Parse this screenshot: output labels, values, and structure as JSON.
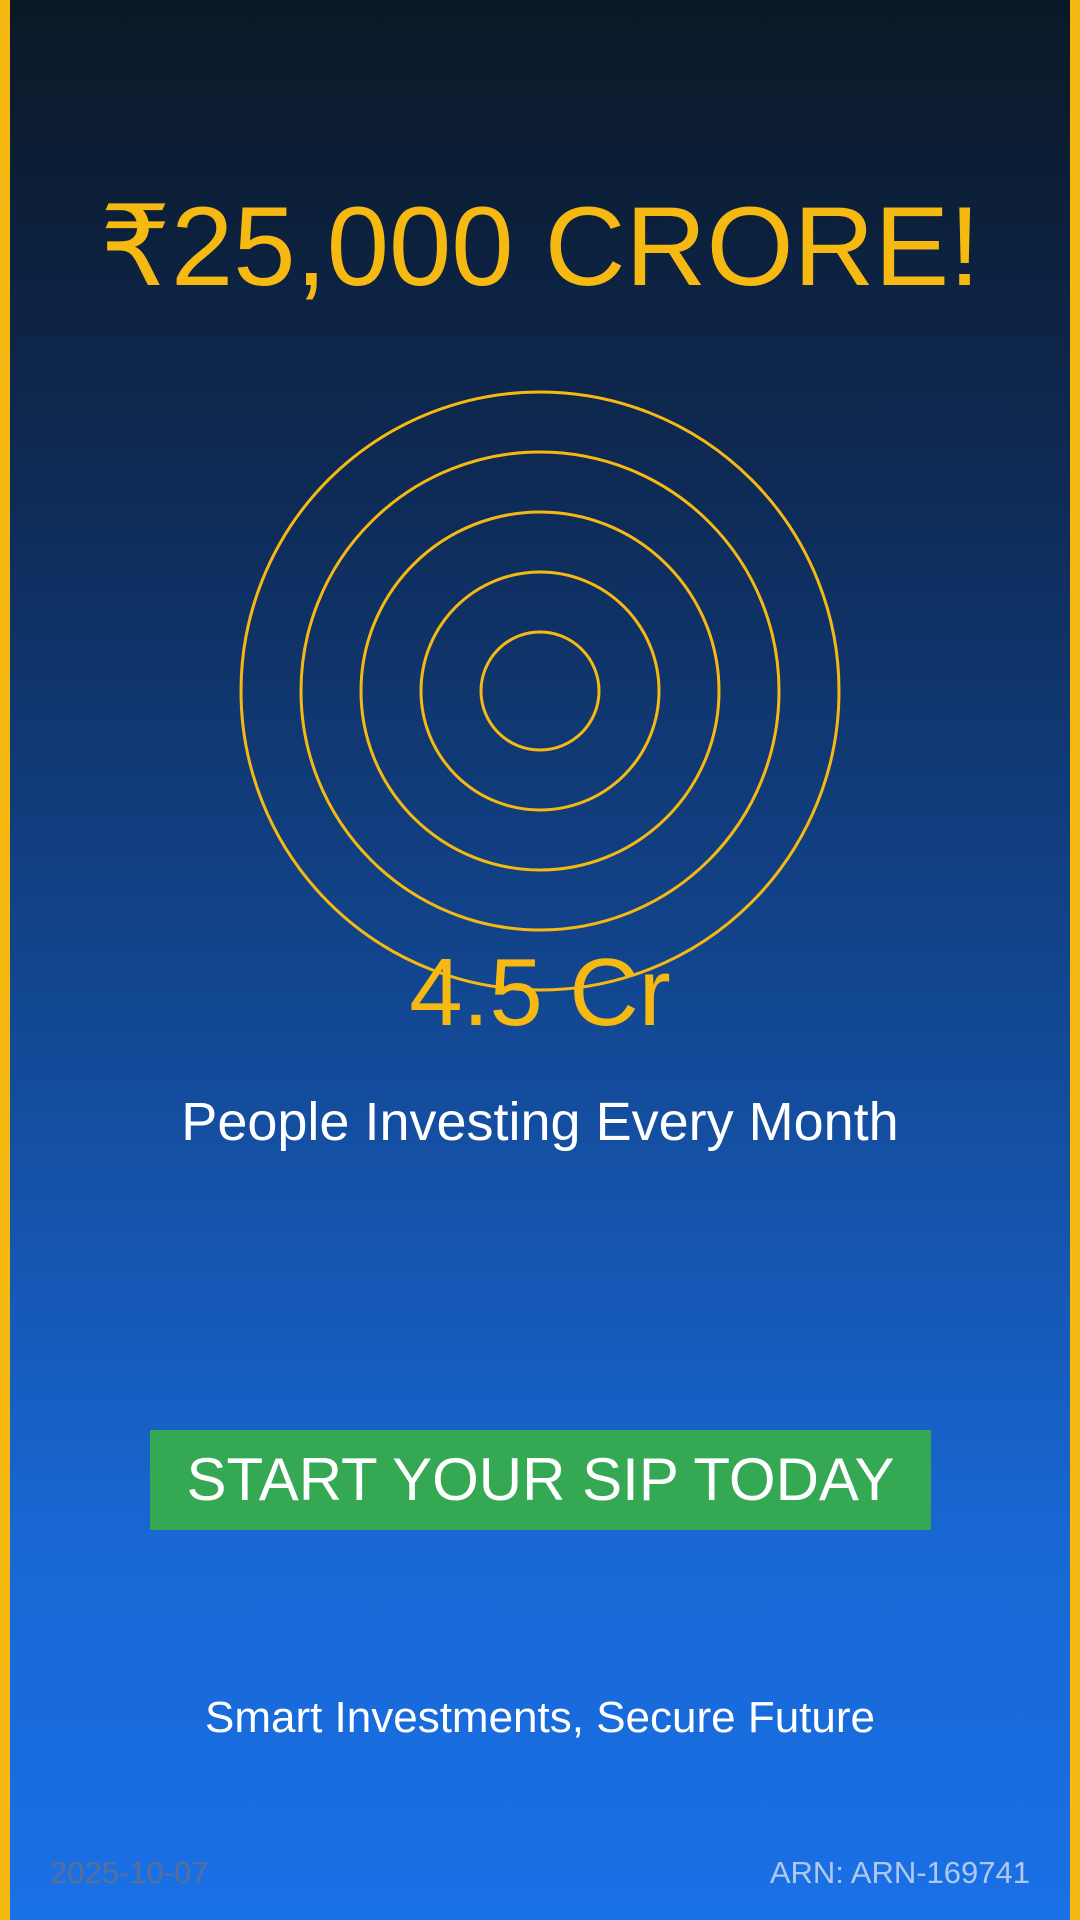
{
  "headline": "₹25,000 CRORE!",
  "stat": {
    "value": "4.5 Cr",
    "label": "People Investing Every Month"
  },
  "cta": {
    "label": "START YOUR SIP TODAY"
  },
  "tagline": "Smart Investments, Secure Future",
  "footer": {
    "date": "2025-10-07",
    "arn": "ARN: ARN-169741"
  },
  "colors": {
    "accent": "#F6B911",
    "cta": "#34A853",
    "background_top": "#0B1826",
    "background_bottom": "#1A70E6"
  },
  "decoration": {
    "icon": "concentric-rings-icon",
    "ring_count": 5
  }
}
